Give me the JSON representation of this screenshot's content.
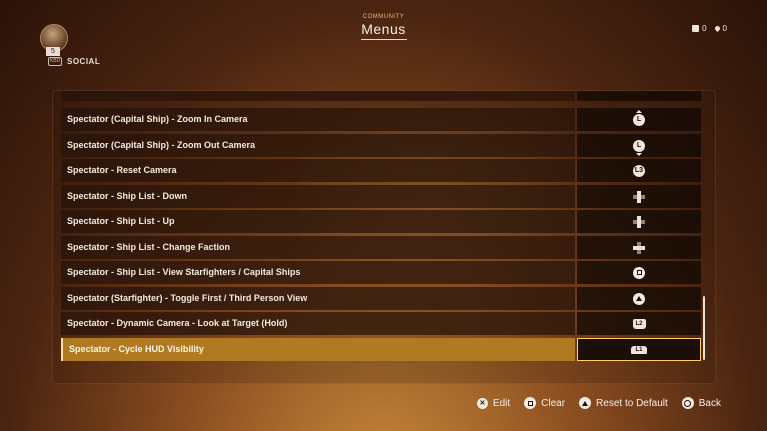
{
  "header": {
    "subtitle": "COMMUNITY",
    "title": "Menus"
  },
  "profile": {
    "level": "5",
    "social_label": "SOCIAL",
    "kbd": "KBD"
  },
  "currencies": [
    {
      "icon": "crate-icon",
      "value": "0"
    },
    {
      "icon": "crystal-icon",
      "value": "0"
    }
  ],
  "bindings": [
    {
      "label": "Spectator (Capital Ship) - Zoom In Camera",
      "button": "left-stick-up-icon",
      "glyph": "L"
    },
    {
      "label": "Spectator (Capital Ship) - Zoom Out Camera",
      "button": "left-stick-down-icon",
      "glyph": "L"
    },
    {
      "label": "Spectator - Reset Camera",
      "button": "l3-icon",
      "glyph": "L3"
    },
    {
      "label": "Spectator - Ship List - Down",
      "button": "dpad-down-icon",
      "glyph": ""
    },
    {
      "label": "Spectator - Ship List - Up",
      "button": "dpad-up-icon",
      "glyph": ""
    },
    {
      "label": "Spectator - Ship List - Change Faction",
      "button": "dpad-left-right-icon",
      "glyph": ""
    },
    {
      "label": "Spectator - Ship List - View Starfighters / Capital Ships",
      "button": "square-button-icon",
      "glyph": ""
    },
    {
      "label": "Spectator (Starfighter) - Toggle First / Third Person View",
      "button": "triangle-button-icon",
      "glyph": ""
    },
    {
      "label": "Spectator - Dynamic Camera - Look at Target (Hold)",
      "button": "l2-trigger-icon",
      "glyph": "L2"
    },
    {
      "label": "Spectator - Cycle HUD Visibility",
      "button": "l1-bumper-icon",
      "glyph": "L1"
    }
  ],
  "selected_index": 9,
  "footer": {
    "edit": "Edit",
    "clear": "Clear",
    "reset": "Reset to Default",
    "back": "Back"
  },
  "colors": {
    "accent": "#b07a22",
    "selection_border": "#ffce6a"
  }
}
